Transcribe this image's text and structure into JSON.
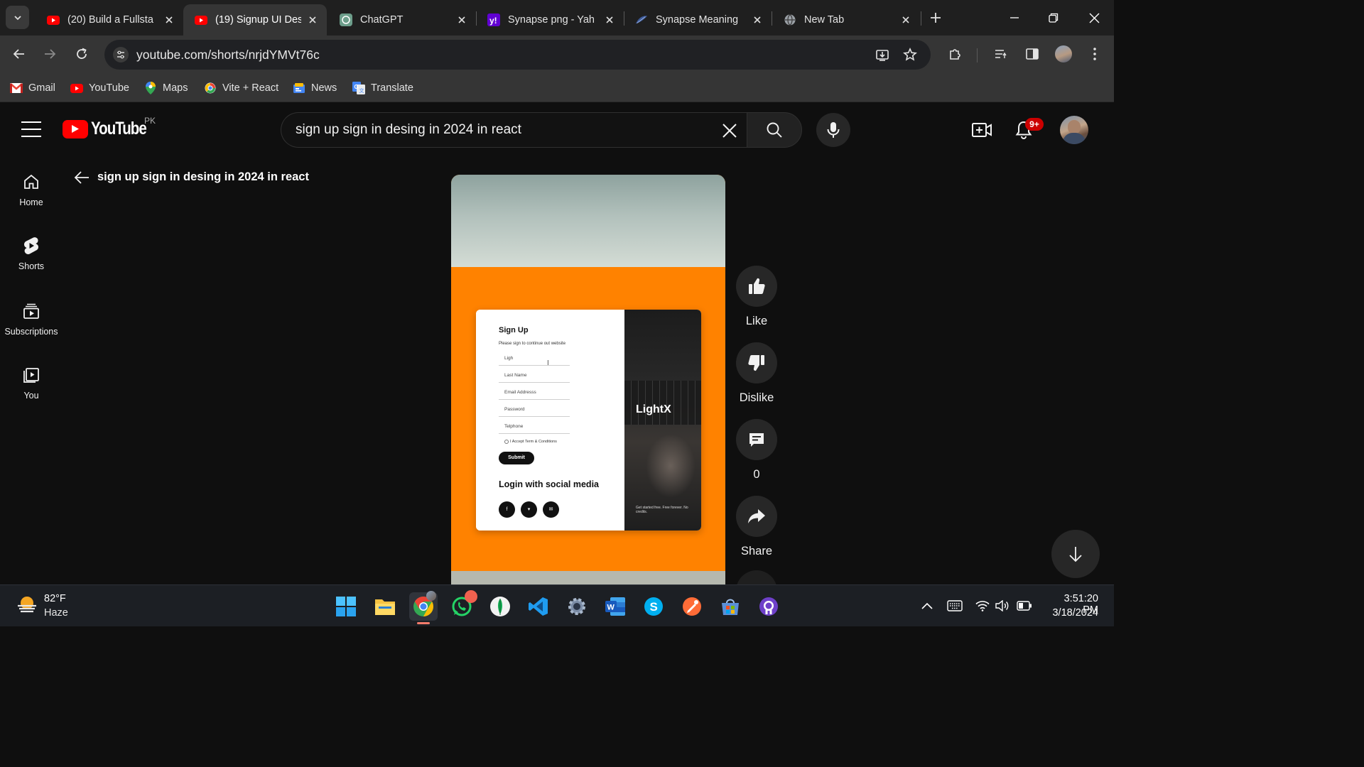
{
  "browser": {
    "tabs": [
      {
        "title": "(20) Build a Fullsta",
        "icon": "youtube-icon",
        "active": false
      },
      {
        "title": "(19) Signup UI Des",
        "icon": "youtube-icon",
        "active": true
      },
      {
        "title": "ChatGPT",
        "icon": "chatgpt-icon",
        "active": false
      },
      {
        "title": "Synapse png - Yah",
        "icon": "yahoo-icon",
        "active": false
      },
      {
        "title": "Synapse Meaning",
        "icon": "feather-icon",
        "active": false
      },
      {
        "title": "New Tab",
        "icon": "globe-icon",
        "active": false
      }
    ],
    "url": "youtube.com/shorts/nrjdYMVt76c",
    "bookmarks": [
      {
        "label": "Gmail",
        "icon": "gmail-icon"
      },
      {
        "label": "YouTube",
        "icon": "youtube-icon"
      },
      {
        "label": "Maps",
        "icon": "maps-icon"
      },
      {
        "label": "Vite + React",
        "icon": "vite-icon"
      },
      {
        "label": "News",
        "icon": "news-icon"
      },
      {
        "label": "Translate",
        "icon": "translate-icon"
      }
    ]
  },
  "youtube": {
    "logo_text": "YouTube",
    "country_code": "PK",
    "search_query": "sign up sign in desing in 2024 in react",
    "notification_count": "9+",
    "sidebar": [
      {
        "label": "Home",
        "icon": "home-icon"
      },
      {
        "label": "Shorts",
        "icon": "shorts-icon"
      },
      {
        "label": "Subscriptions",
        "icon": "subscriptions-icon"
      },
      {
        "label": "You",
        "icon": "you-icon"
      }
    ],
    "page_title": "sign up sign in desing in 2024 in react",
    "actions": {
      "like": "Like",
      "dislike": "Dislike",
      "comments": "0",
      "share": "Share"
    },
    "video": {
      "heading": "Sign Up",
      "subheading": "Please sign to continue out website",
      "fields": [
        "Ligh",
        "Last Name",
        "Email Addresss",
        "Password",
        "Telphone"
      ],
      "terms": "I Accept Term & Conditions",
      "submit": "Submit",
      "social_heading": "Login with social media",
      "brand": "LightX",
      "footer": "Get started free. Free forever. No credits.",
      "colors": {
        "accent": "#ff8200"
      }
    }
  },
  "taskbar": {
    "weather_temp": "82°F",
    "weather_desc": "Haze",
    "time": "3:51:20 PM",
    "date": "3/18/2024",
    "apps": [
      "windows-start-icon",
      "file-explorer-icon",
      "chrome-icon",
      "whatsapp-icon",
      "mongodb-compass-icon",
      "vscode-icon",
      "settings-icon",
      "word-icon",
      "skype-icon",
      "postman-icon",
      "store-icon",
      "github-desktop-icon"
    ]
  }
}
